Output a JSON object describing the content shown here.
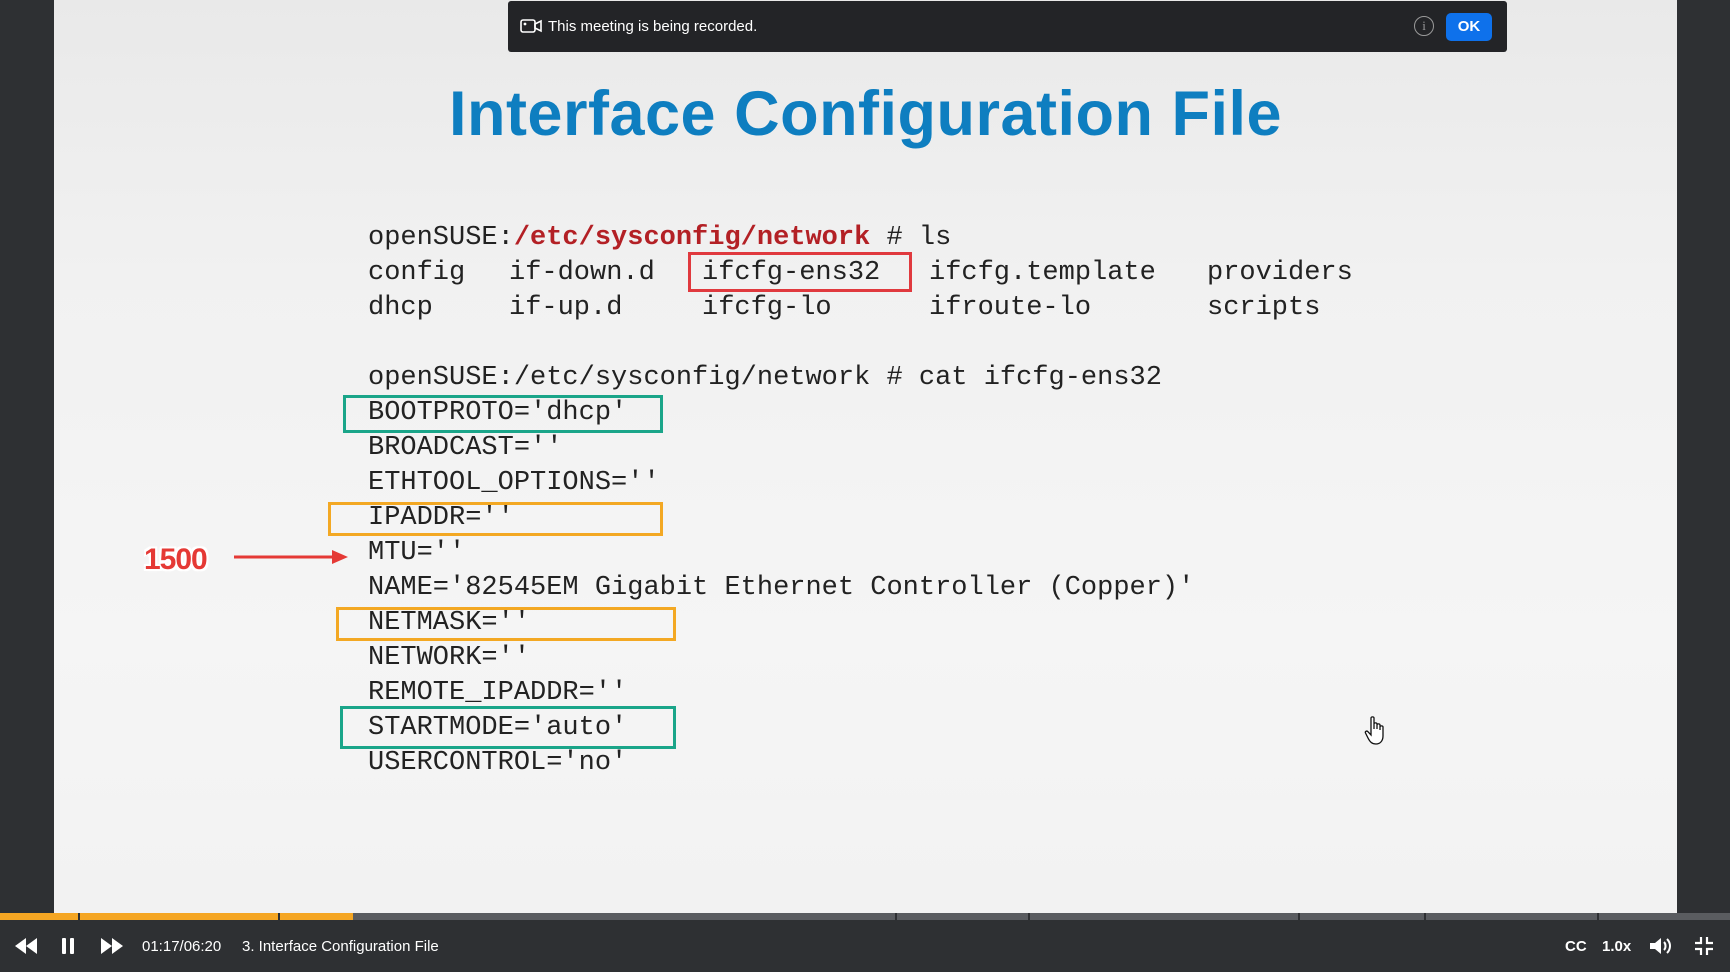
{
  "banner": {
    "message": "This meeting is being recorded.",
    "ok_label": "OK",
    "info_glyph": "i"
  },
  "slide": {
    "title": "Interface Configuration File",
    "prompt1_prefix": "openSUSE:",
    "prompt1_path": "/etc/sysconfig/network",
    "prompt1_cmd": " # ls",
    "ls_row1": [
      "config",
      "if-down.d",
      "ifcfg-ens32",
      "ifcfg.template",
      "providers"
    ],
    "ls_row2": [
      "dhcp",
      "if-up.d",
      "ifcfg-lo",
      "ifroute-lo",
      "scripts"
    ],
    "prompt2": "openSUSE:/etc/sysconfig/network # cat ifcfg-ens32",
    "config_lines": [
      "BOOTPROTO='dhcp'",
      "BROADCAST=''",
      "ETHTOOL_OPTIONS=''",
      "IPADDR=''",
      "MTU=''",
      "NAME='82545EM Gigabit Ethernet Controller (Copper)'",
      "NETMASK=''",
      "NETWORK=''",
      "REMOTE_IPADDR=''",
      "STARTMODE='auto'",
      "USERCONTROL='no'"
    ],
    "annotation": "1500"
  },
  "player": {
    "time": "01:17/06:20",
    "chapter": "3. Interface Configuration File",
    "cc_label": "CC",
    "speed": "1.0x",
    "progress": 0.204
  },
  "colors": {
    "title": "#0e7ec0",
    "path": "#b32025",
    "box_red": "#e0393e",
    "box_green": "#1aa589",
    "box_orange": "#f3a823",
    "progress_fill": "#f5a623",
    "ok_button": "#0e71eb"
  }
}
